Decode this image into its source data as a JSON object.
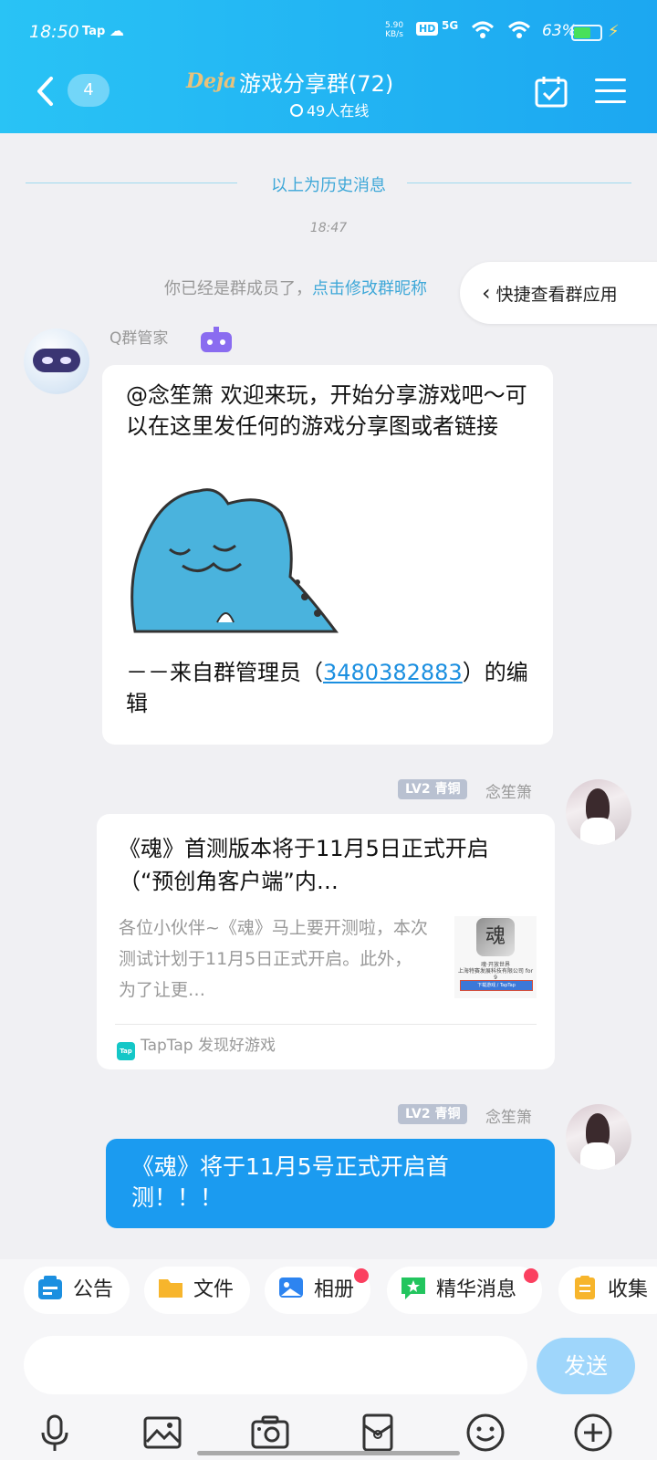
{
  "status_bar": {
    "time": "18:50",
    "tap_label": "Tap",
    "speed_value": "5.90",
    "speed_unit": "KB/s",
    "hd": "HD",
    "network": "5G",
    "battery": "63%",
    "battery_level": 0.63
  },
  "header": {
    "unread_count": "4",
    "brand_logo_text": "Deja",
    "title": "游戏分享群(72)",
    "online": "49人在线"
  },
  "chat": {
    "history_divider": "以上为历史消息",
    "timestamp": "18:47",
    "system_notice": "你已经是群成员了，",
    "system_link": "点击修改群昵称",
    "quick_apps": "快捷查看群应用",
    "messages": [
      {
        "sender": "Q群管家",
        "text": "@念笙箫 欢迎来玩，开始分享游戏吧～可以在这里发任何的游戏分享图或者链接",
        "footer_prefix": "－－来自群管理员（",
        "footer_qq": "3480382883",
        "footer_suffix": "）的编辑"
      },
      {
        "sender": "念笙箫",
        "level": "LV2 青铜",
        "card_title": "《魂》首测版本将于11月5日正式开启（“预创角客户端”内…",
        "card_desc": "各位小伙伴~《魂》马上要开测啦，本次测试计划于11月5日正式开启。此外，为了让更…",
        "thumb_glyph": "魂",
        "thumb_line1": "魂·开放世界",
        "thumb_line2": "上海特赛发展科技有限公司 for 9",
        "thumb_button": "下载游戏 / TapTap",
        "source_icon": "Tap",
        "source": "TapTap 发现好游戏"
      },
      {
        "sender": "念笙箫",
        "level": "LV2 青铜",
        "text": "《魂》将于11月5号正式开启首测！！！"
      }
    ]
  },
  "shortcuts": [
    {
      "label": "公告",
      "icon": "announcement-icon",
      "color": "#1b8fe0",
      "dot": false
    },
    {
      "label": "文件",
      "icon": "folder-icon",
      "color": "#f7b52c",
      "dot": false
    },
    {
      "label": "相册",
      "icon": "album-icon",
      "color": "#2d84f0",
      "dot": true
    },
    {
      "label": "精华消息",
      "icon": "featured-message-icon",
      "color": "#22c55e",
      "dot": true
    },
    {
      "label": "收集",
      "icon": "collect-icon",
      "color": "#f7b52c",
      "dot": false
    }
  ],
  "input": {
    "placeholder": "",
    "send_label": "发送"
  },
  "toolbar": [
    "microphone-icon",
    "gallery-icon",
    "camera-icon",
    "red-packet-icon",
    "emoji-icon",
    "plus-icon"
  ]
}
